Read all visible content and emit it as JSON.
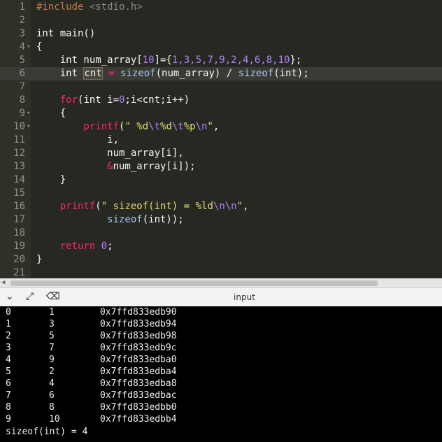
{
  "editor": {
    "line_numbers": [
      "1",
      "2",
      "3",
      "4",
      "5",
      "6",
      "7",
      "8",
      "9",
      "10",
      "11",
      "12",
      "13",
      "14",
      "15",
      "16",
      "17",
      "18",
      "19",
      "20",
      "21"
    ],
    "l1": {
      "pre": "#include ",
      "inc": "<stdio.h>"
    },
    "l3": {
      "a": "int main()"
    },
    "l4": {
      "a": "{"
    },
    "l5": {
      "a": "    int num_array[",
      "n10": "10",
      "b": "]={",
      "v": "1,3,5,7,9,2,4,6,8,10",
      "c": "};"
    },
    "l6": {
      "a": "    int ",
      "sel": "cnt",
      "b": " = ",
      "fn1": "sizeof",
      "c": "(num_array) / ",
      "fn2": "sizeof",
      "d": "(int);"
    },
    "l8": {
      "kw": "    for",
      "a": "(int i=",
      "z": "0",
      "b": ";i<cnt;i++)"
    },
    "l9": {
      "a": "    {"
    },
    "l10": {
      "fn": "        printf",
      "a": "(",
      "s1": "\" %d",
      "e1": "\\t",
      "s2": "%d",
      "e2": "\\t",
      "s3": "%p",
      "e3": "\\n",
      "s4": "\"",
      "b": ","
    },
    "l11": {
      "a": "            i,"
    },
    "l12": {
      "a": "            num_array[i],"
    },
    "l13": {
      "amp": "            &",
      "a": "num_array[i]);"
    },
    "l14": {
      "a": "    }"
    },
    "l16": {
      "fn": "    printf",
      "a": "(",
      "s1": "\" sizeof(int) = %ld",
      "e1": "\\n\\n",
      "s2": "\"",
      "b": ","
    },
    "l17": {
      "fn": "            sizeof",
      "a": "(int));"
    },
    "l19": {
      "kw": "    return ",
      "z": "0",
      "a": ";"
    },
    "l20": {
      "a": "}"
    }
  },
  "toolbar": {
    "title": "input",
    "icons": [
      "chevron-down-icon",
      "expand-icon",
      "clear-console-icon"
    ]
  },
  "console": {
    "rows": [
      [
        "0",
        "1",
        "0x7ffd833edb90"
      ],
      [
        "1",
        "3",
        "0x7ffd833edb94"
      ],
      [
        "2",
        "5",
        "0x7ffd833edb98"
      ],
      [
        "3",
        "7",
        "0x7ffd833edb9c"
      ],
      [
        "4",
        "9",
        "0x7ffd833edba0"
      ],
      [
        "5",
        "2",
        "0x7ffd833edba4"
      ],
      [
        "6",
        "4",
        "0x7ffd833edba8"
      ],
      [
        "7",
        "6",
        "0x7ffd833edbac"
      ],
      [
        "8",
        "8",
        "0x7ffd833edbb0"
      ],
      [
        "9",
        "10",
        "0x7ffd833edbb4"
      ]
    ],
    "summary": "sizeof(int) = 4"
  },
  "colors": {
    "editor_bg": "#272822",
    "keyword": "#f92672",
    "string": "#e6db74",
    "number": "#ae81ff",
    "function": "#a6c8f0",
    "console_bg": "#000000"
  }
}
